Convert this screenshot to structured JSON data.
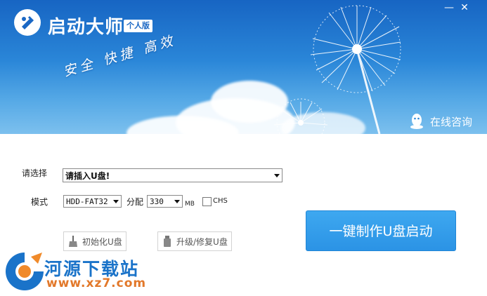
{
  "window": {
    "title": "启动大师",
    "edition": "个人版",
    "minimize": "—",
    "close": "✕"
  },
  "banner": {
    "slogan": "安全 快捷 高效",
    "consult_label": "在线咨询"
  },
  "form": {
    "select_label": "请选择",
    "device_value": "请插入U盘!",
    "mode_label": "模式",
    "mode_value": "HDD-FAT32",
    "alloc_label": "分配",
    "alloc_value": "330",
    "alloc_unit": "MB",
    "chs_label": "CHS",
    "chs_checked": false
  },
  "actions": {
    "init_label": "初始化U盘",
    "upgrade_label": "升级/修复U盘",
    "oneclick_label": "一键制作U盘启动"
  },
  "watermark": {
    "name": "河源下载站",
    "url": "www.xz7.com"
  },
  "colors": {
    "banner_blue": "#1765c3",
    "button_blue": "#2b93e5",
    "watermark_blue": "#1a73c9",
    "watermark_orange": "#e2782a"
  }
}
